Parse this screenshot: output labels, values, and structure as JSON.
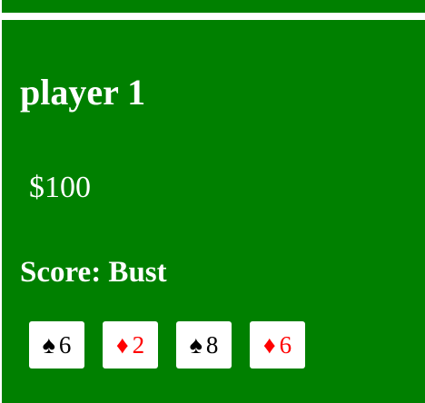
{
  "player": {
    "name": "player 1",
    "money": "$100",
    "score": "Score: Bust"
  },
  "hand": [
    {
      "suit": "♠",
      "rank": "6",
      "color": "#000000"
    },
    {
      "suit": "♦",
      "rank": "2",
      "color": "#ff0000"
    },
    {
      "suit": "♠",
      "rank": "8",
      "color": "#000000"
    },
    {
      "suit": "♦",
      "rank": "6",
      "color": "#ff0000"
    }
  ],
  "colors": {
    "table_green": "#008000",
    "card_face": "#ffffff"
  }
}
